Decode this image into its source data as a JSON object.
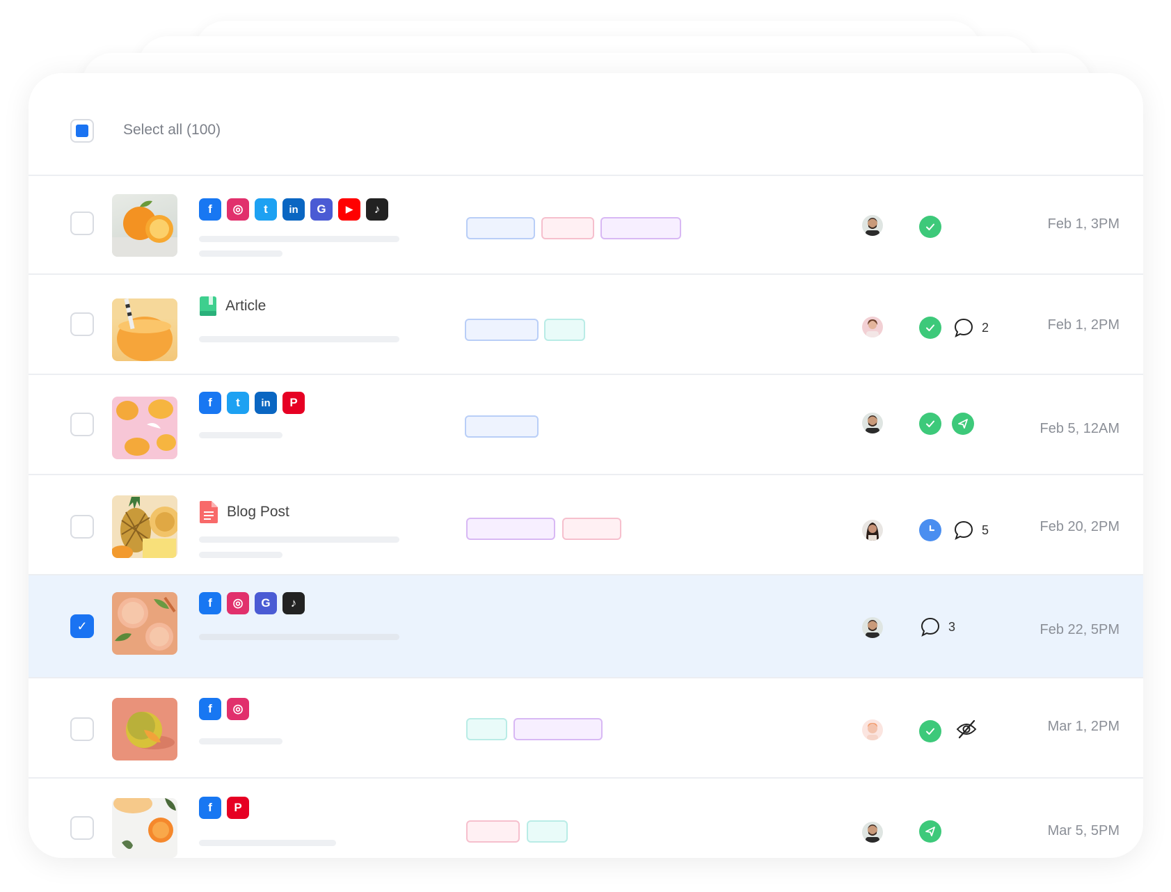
{
  "header": {
    "select_all_label": "Select all (100)"
  },
  "rows": [
    {
      "type_label": "",
      "date": "Feb 1, 3PM",
      "comments": "",
      "selected": false
    },
    {
      "type_label": "Article",
      "date": "Feb 1, 2PM",
      "comments": "2",
      "selected": false
    },
    {
      "type_label": "",
      "date": "Feb 5, 12AM",
      "comments": "",
      "selected": false
    },
    {
      "type_label": "Blog Post",
      "date": "Feb 20, 2PM",
      "comments": "5",
      "selected": false
    },
    {
      "type_label": "",
      "date": "Feb 22, 5PM",
      "comments": "3",
      "selected": true
    },
    {
      "type_label": "",
      "date": "Mar 1, 2PM",
      "comments": "",
      "selected": false
    },
    {
      "type_label": "",
      "date": "Mar 5, 5PM",
      "comments": "",
      "selected": false
    }
  ],
  "colors": {
    "accent": "#1a73f2",
    "selected_row": "#ebf3fd",
    "status_green": "#3dc97a",
    "status_blue": "#4a8ef0",
    "facebook": "#1877f2",
    "instagram": "#e1306c",
    "twitter": "#1da1f2",
    "linkedin": "#0a66c2",
    "google": "#4a5bd4",
    "youtube": "#ff0000",
    "tiktok": "#222222",
    "pinterest": "#e60023"
  },
  "icons": {
    "row1": [
      "facebook-icon",
      "instagram-icon",
      "twitter-icon",
      "linkedin-icon",
      "google-icon",
      "youtube-icon",
      "tiktok-icon"
    ],
    "row3": [
      "facebook-icon",
      "twitter-icon",
      "linkedin-icon",
      "pinterest-icon"
    ],
    "row5": [
      "facebook-icon",
      "instagram-icon",
      "google-icon",
      "tiktok-icon"
    ],
    "row6": [
      "facebook-icon",
      "instagram-icon"
    ],
    "row7": [
      "facebook-icon",
      "pinterest-icon"
    ]
  }
}
